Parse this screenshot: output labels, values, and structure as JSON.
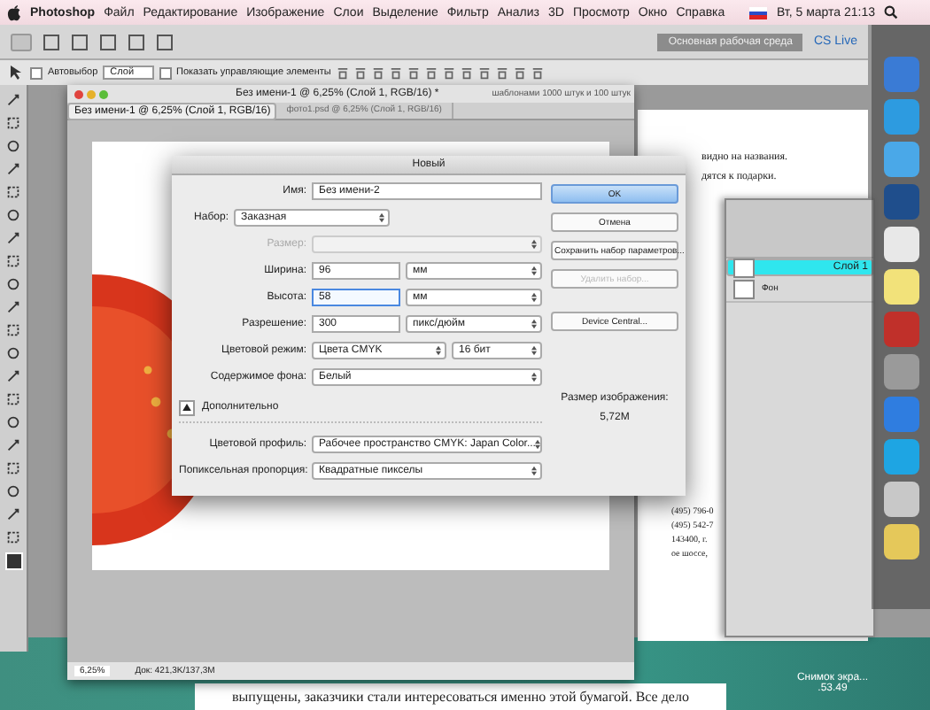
{
  "menu_bar": {
    "app": "Photoshop",
    "items": [
      "Файл",
      "Редактирование",
      "Изображение",
      "Слои",
      "Выделение",
      "Фильтр",
      "Анализ",
      "3D",
      "Просмотр",
      "Окно",
      "Справка"
    ],
    "clock": "Вт, 5 марта 21:13"
  },
  "options_bar": {
    "auto_select": {
      "label": "Автовыбор",
      "checked": false
    },
    "target": "Слой",
    "show_controls": {
      "label": "Показать управляющие элементы",
      "checked": false
    },
    "workspace": "Основная рабочая среда",
    "cs_live": "CS Live"
  },
  "document": {
    "title": "Без имени-1 @ 6,25% (Слой 1, RGB/16) *",
    "tabs": [
      {
        "label": "Без имени-1 @ 6,25% (Слой 1, RGB/16)",
        "selected": true
      },
      {
        "label": "фото1.psd @ 6,25% (Слой 1, RGB/16)",
        "selected": false
      }
    ],
    "zoom": "6,25%",
    "doc_info": "Док: 421,3K/137,3M"
  },
  "web_page": {
    "header": "шаблонами 1000 штук и 100 штук",
    "lines": [
      "видно на названия.",
      "дятся к подарки."
    ],
    "contacts": [
      "(495) 796-0",
      "(495) 542-7",
      "143400, г.",
      "ое шоссе,"
    ],
    "bottom_text": "выпущены, заказчики стали интересоваться именно этой бумагой. Все дело"
  },
  "dialog": {
    "title": "Новый",
    "fields": [
      {
        "kind": "text",
        "label": "Имя:",
        "value": "Без имени-2",
        "disabled": false,
        "focused": false
      },
      {
        "kind": "preset",
        "label": "Набор:",
        "value": "Заказная",
        "disabled": false,
        "focused": false
      },
      {
        "kind": "select",
        "label": "Размер:",
        "disabled": true,
        "focused": false
      },
      {
        "kind": "number",
        "label": "Ширина:",
        "value": "96",
        "unit": "мм",
        "disabled": false,
        "focused": false
      },
      {
        "kind": "number",
        "label": "Высота:",
        "value": "58",
        "unit": "мм",
        "disabled": false,
        "focused": true
      },
      {
        "kind": "number",
        "label": "Разрешение:",
        "value": "300",
        "unit": "пикс/дюйм",
        "disabled": false,
        "focused": false
      },
      {
        "kind": "pair",
        "label": "Цветовой режим:",
        "value": "Цвета CMYK",
        "unit": "16 бит",
        "disabled": false,
        "focused": false
      },
      {
        "kind": "select",
        "label": "Содержимое фона:",
        "value": "Белый",
        "disabled": false,
        "focused": false
      }
    ],
    "advanced": {
      "label": "Дополнительно",
      "expanded": true,
      "fields": [
        {
          "label": "Цветовой профиль:",
          "value": "Рабочее пространство CMYK: Japan Color..."
        },
        {
          "label": "Попиксельная пропорция:",
          "value": "Квадратные пикселы"
        }
      ]
    },
    "buttons": [
      {
        "label": "OK",
        "default": true,
        "disabled": false
      },
      {
        "label": "Отмена",
        "default": false,
        "disabled": false
      },
      {
        "label": "Сохранить набор параметров...",
        "default": false,
        "disabled": false
      },
      {
        "label": "Удалить набор...",
        "default": false,
        "disabled": true
      },
      {
        "label": "Device Central...",
        "default": false,
        "disabled": false
      }
    ],
    "image_size": {
      "label": "Размер изображения:",
      "value": "5,72M"
    }
  },
  "layers_panel": {
    "layers": [
      {
        "name": "Слой 1",
        "selected": true
      },
      {
        "name": "Фон",
        "selected": false
      }
    ]
  },
  "desktop": {
    "file_label": "Снимок экра... .53.49"
  }
}
